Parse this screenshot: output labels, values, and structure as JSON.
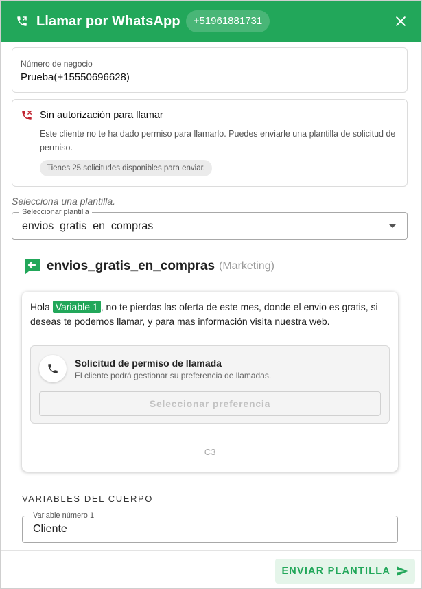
{
  "header": {
    "title": "Llamar por WhatsApp",
    "phone": "+51961881731"
  },
  "business": {
    "label": "Número de negocio",
    "value": "Prueba(+15550696628)"
  },
  "authorization": {
    "title": "Sin autorización para llamar",
    "description": "Este cliente no te ha dado permiso para llamarlo. Puedes enviarle una plantilla de solicitud de permiso.",
    "chip": "Tienes 25 solicitudes disponibles para enviar."
  },
  "template_select": {
    "hint": "Selecciona una plantilla.",
    "label": "Seleccionar plantilla",
    "value": "envios_gratis_en_compras"
  },
  "template": {
    "name": "envios_gratis_en_compras",
    "category": "(Marketing)",
    "body_prefix": "Hola ",
    "variable": "Variable 1",
    "body_suffix": ", no te pierdas las oferta de este mes, donde el envio es gratis, si deseas te podemos llamar, y para mas información visita nuestra web.",
    "permission": {
      "title": "Solicitud de permiso de llamada",
      "subtitle": "El cliente podrá gestionar su preferencia de llamadas.",
      "button": "Seleccionar preferencia"
    },
    "footer": "C3"
  },
  "variables": {
    "title": "VARIABLES DEL CUERPO",
    "field_label": "Variable número 1",
    "field_value": "Cliente"
  },
  "actions": {
    "send": "ENVIAR PLANTILLA"
  },
  "colors": {
    "brand": "#22a75a",
    "alert": "#c0222e"
  }
}
